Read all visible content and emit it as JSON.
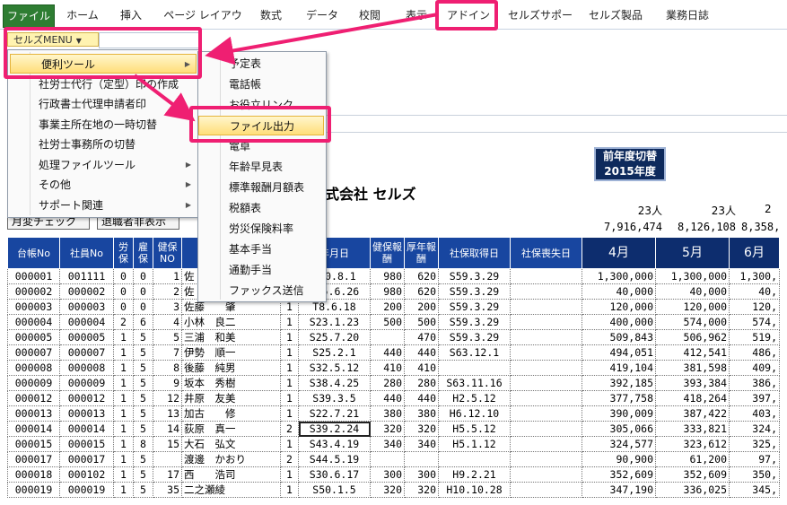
{
  "ribbon": {
    "tabs": [
      "ファイル",
      "ホーム",
      "挿入",
      "ページ レイアウト",
      "数式",
      "データ",
      "校閲",
      "表示",
      "アドイン",
      "セルズサポート",
      "セルズ製品",
      "業務日誌"
    ]
  },
  "addin_menu_label": "セルズMENU",
  "main_menu": {
    "items": [
      {
        "label": "便利ツール",
        "submenu": true
      },
      {
        "label": "社労士代行（定型）印の作成",
        "submenu": false
      },
      {
        "label": "行政書士代理申請者印",
        "submenu": false
      },
      {
        "label": "事業主所在地の一時切替",
        "submenu": false
      },
      {
        "label": "社労士事務所の切替",
        "submenu": false
      },
      {
        "label": "処理ファイルツール",
        "submenu": true
      },
      {
        "label": "その他",
        "submenu": true
      },
      {
        "label": "サポート関連",
        "submenu": true
      }
    ]
  },
  "sub_menu": {
    "items": [
      "予定表",
      "電話帳",
      "お役立リンク",
      "ファイル出力",
      "電卓",
      "年齢早見表",
      "標準報酬月額表",
      "税額表",
      "労災保険料率",
      "基本手当",
      "通勤手当",
      "ファックス送信"
    ]
  },
  "sheet": {
    "zengo_line1": "前年度切替",
    "zengo_line2": "2015年度",
    "company": "式会社 セルズ",
    "btn1": "月変チェック",
    "btn2": "退職者非表示",
    "counts": [
      "23人",
      "23人",
      "2"
    ],
    "totals": [
      "7,916,474",
      "8,126,108",
      "8,358,"
    ],
    "headers": [
      "台帳No",
      "社員No",
      "労保",
      "雇保",
      "健保NO",
      "",
      "",
      "年月日",
      "健保報酬",
      "厚年報酬",
      "社保取得日",
      "社保喪失日",
      "4月",
      "5月",
      "6月"
    ],
    "rows": [
      [
        "000001",
        "001111",
        "0",
        "0",
        "1",
        "佐",
        "",
        "S40.8.1",
        "980",
        "620",
        "S59.3.29",
        "",
        "1,300,000",
        "1,300,000",
        "1,300,"
      ],
      [
        "000002",
        "000002",
        "0",
        "0",
        "2",
        "佐",
        "",
        "S25.6.26",
        "980",
        "620",
        "S59.3.29",
        "",
        "40,000",
        "40,000",
        "40,"
      ],
      [
        "000003",
        "000003",
        "0",
        "0",
        "3",
        "佐藤　　肇",
        "1",
        "T8.6.18",
        "200",
        "200",
        "S59.3.29",
        "",
        "120,000",
        "120,000",
        "120,"
      ],
      [
        "000004",
        "000004",
        "2",
        "6",
        "4",
        "小林　良二",
        "1",
        "S23.1.23",
        "500",
        "500",
        "S59.3.29",
        "",
        "400,000",
        "574,000",
        "574,"
      ],
      [
        "000005",
        "000005",
        "1",
        "5",
        "5",
        "三浦　和美",
        "1",
        "S25.7.20",
        "",
        "470",
        "S59.3.29",
        "",
        "509,843",
        "506,962",
        "519,"
      ],
      [
        "000007",
        "000007",
        "1",
        "5",
        "7",
        "伊勢　順一",
        "1",
        "S25.2.1",
        "440",
        "440",
        "S63.12.1",
        "",
        "494,051",
        "412,541",
        "486,"
      ],
      [
        "000008",
        "000008",
        "1",
        "5",
        "8",
        "後藤　純男",
        "1",
        "S32.5.12",
        "410",
        "410",
        "",
        "",
        "419,104",
        "381,598",
        "409,"
      ],
      [
        "000009",
        "000009",
        "1",
        "5",
        "9",
        "坂本　秀樹",
        "1",
        "S38.4.25",
        "280",
        "280",
        "S63.11.16",
        "",
        "392,185",
        "393,384",
        "386,"
      ],
      [
        "000012",
        "000012",
        "1",
        "5",
        "12",
        "井原　友美",
        "1",
        "S39.3.5",
        "440",
        "440",
        "H2.5.12",
        "",
        "377,758",
        "418,264",
        "397,"
      ],
      [
        "000013",
        "000013",
        "1",
        "5",
        "13",
        "加古　　修",
        "1",
        "S22.7.21",
        "380",
        "380",
        "H6.12.10",
        "",
        "390,009",
        "387,422",
        "403,"
      ],
      [
        "000014",
        "000014",
        "1",
        "5",
        "14",
        "荻原　真一",
        "2",
        "S39.2.24",
        "320",
        "320",
        "H5.5.12",
        "",
        "305,066",
        "333,821",
        "324,"
      ],
      [
        "000015",
        "000015",
        "1",
        "8",
        "15",
        "大石　弘文",
        "1",
        "S43.4.19",
        "340",
        "340",
        "H5.1.12",
        "",
        "324,577",
        "323,612",
        "325,"
      ],
      [
        "000017",
        "000017",
        "1",
        "5",
        "",
        "渡邊　かおり",
        "2",
        "S44.5.19",
        "",
        "",
        "",
        "",
        "90,900",
        "61,200",
        "97,"
      ],
      [
        "000018",
        "000102",
        "1",
        "5",
        "17",
        "西　　浩司",
        "1",
        "S30.6.17",
        "300",
        "300",
        "H9.2.21",
        "",
        "352,609",
        "352,609",
        "350,"
      ],
      [
        "000019",
        "000019",
        "1",
        "5",
        "35",
        "二之瀬綾",
        "1",
        "S50.1.5",
        "320",
        "320",
        "H10.10.28",
        "",
        "347,190",
        "336,025",
        "345,"
      ]
    ]
  }
}
